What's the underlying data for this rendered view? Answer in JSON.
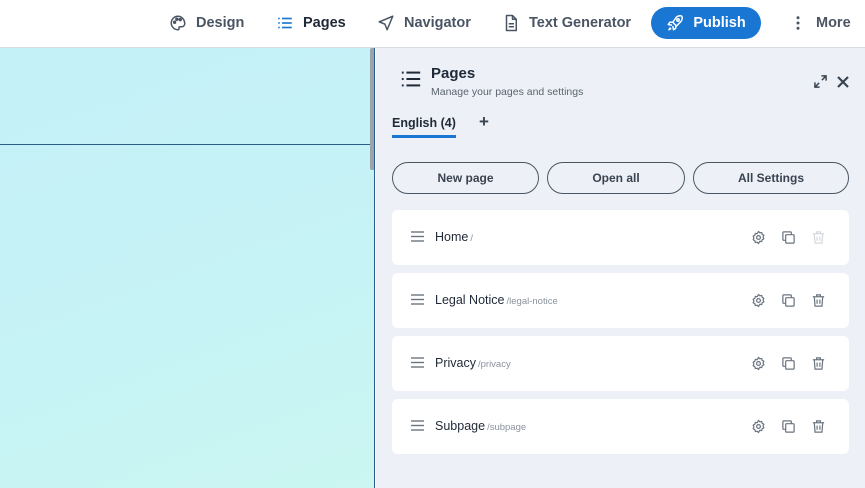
{
  "topbar": {
    "design_label": "Design",
    "pages_label": "Pages",
    "navigator_label": "Navigator",
    "text_generator_label": "Text Generator",
    "publish_label": "Publish",
    "more_label": "More"
  },
  "panel": {
    "title": "Pages",
    "subtitle": "Manage your pages and settings",
    "language_tab": "English (4)",
    "add_language": "+",
    "buttons": {
      "new_page": "New page",
      "open_all": "Open all",
      "all_settings": "All Settings"
    },
    "pages": [
      {
        "name": "Home",
        "path": "/",
        "trash_enabled": false
      },
      {
        "name": "Legal Notice",
        "path": "/legal-notice",
        "trash_enabled": true
      },
      {
        "name": "Privacy",
        "path": "/privacy",
        "trash_enabled": true
      },
      {
        "name": "Subpage",
        "path": "/subpage",
        "trash_enabled": true
      }
    ]
  },
  "colors": {
    "accent": "#1976d2",
    "panel_bg": "#edf1f7",
    "canvas_bg": "#c4f0f8"
  }
}
